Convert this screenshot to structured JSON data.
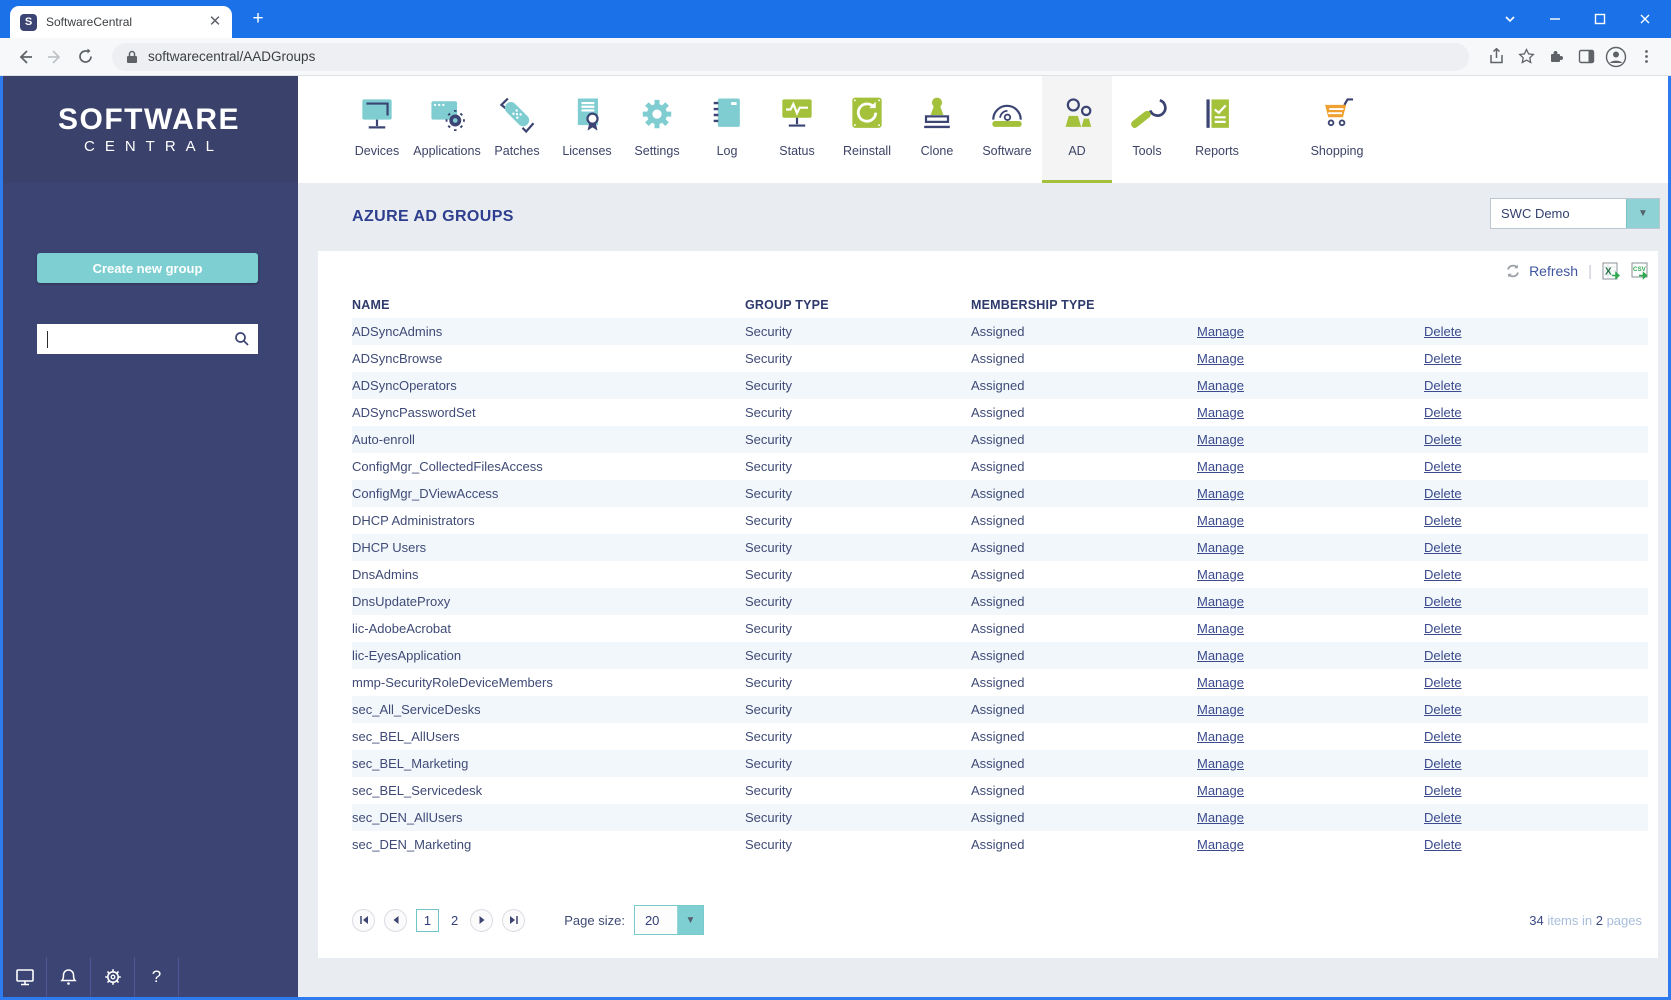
{
  "browser": {
    "tab_title": "SoftwareCentral",
    "favicon_letter": "S",
    "url": "softwarecentral/AADGroups",
    "new_tab_label": "+"
  },
  "sidebar": {
    "logo_line1": "SOFTWARE",
    "logo_line2": "CENTRAL",
    "create_button_label": "Create new group",
    "search_value": ""
  },
  "nav": {
    "active_label": "AD",
    "items": [
      {
        "label": "Devices",
        "icon": "devices-icon"
      },
      {
        "label": "Applications",
        "icon": "applications-icon"
      },
      {
        "label": "Patches",
        "icon": "patches-icon"
      },
      {
        "label": "Licenses",
        "icon": "licenses-icon"
      },
      {
        "label": "Settings",
        "icon": "settings-icon"
      },
      {
        "label": "Log",
        "icon": "log-icon"
      },
      {
        "label": "Status",
        "icon": "status-icon"
      },
      {
        "label": "Reinstall",
        "icon": "reinstall-icon"
      },
      {
        "label": "Clone",
        "icon": "clone-icon"
      },
      {
        "label": "Software",
        "icon": "software-icon"
      },
      {
        "label": "AD",
        "icon": "ad-icon"
      },
      {
        "label": "Tools",
        "icon": "tools-icon"
      },
      {
        "label": "Reports",
        "icon": "reports-icon"
      },
      {
        "label": "Shopping",
        "icon": "shopping-icon",
        "gap_before": true
      }
    ]
  },
  "page": {
    "title": "AZURE AD GROUPS",
    "environment_value": "SWC Demo",
    "refresh_label": "Refresh",
    "separator": "|"
  },
  "table": {
    "columns": [
      "NAME",
      "GROUP TYPE",
      "MEMBERSHIP TYPE"
    ],
    "manage_label": "Manage",
    "delete_label": "Delete",
    "rows": [
      {
        "name": "ADSyncAdmins",
        "group_type": "Security",
        "membership_type": "Assigned"
      },
      {
        "name": "ADSyncBrowse",
        "group_type": "Security",
        "membership_type": "Assigned"
      },
      {
        "name": "ADSyncOperators",
        "group_type": "Security",
        "membership_type": "Assigned"
      },
      {
        "name": "ADSyncPasswordSet",
        "group_type": "Security",
        "membership_type": "Assigned"
      },
      {
        "name": "Auto-enroll",
        "group_type": "Security",
        "membership_type": "Assigned"
      },
      {
        "name": "ConfigMgr_CollectedFilesAccess",
        "group_type": "Security",
        "membership_type": "Assigned"
      },
      {
        "name": "ConfigMgr_DViewAccess",
        "group_type": "Security",
        "membership_type": "Assigned"
      },
      {
        "name": "DHCP Administrators",
        "group_type": "Security",
        "membership_type": "Assigned"
      },
      {
        "name": "DHCP Users",
        "group_type": "Security",
        "membership_type": "Assigned"
      },
      {
        "name": "DnsAdmins",
        "group_type": "Security",
        "membership_type": "Assigned"
      },
      {
        "name": "DnsUpdateProxy",
        "group_type": "Security",
        "membership_type": "Assigned"
      },
      {
        "name": "lic-AdobeAcrobat",
        "group_type": "Security",
        "membership_type": "Assigned"
      },
      {
        "name": "lic-EyesApplication",
        "group_type": "Security",
        "membership_type": "Assigned"
      },
      {
        "name": "mmp-SecurityRoleDeviceMembers",
        "group_type": "Security",
        "membership_type": "Assigned"
      },
      {
        "name": "sec_All_ServiceDesks",
        "group_type": "Security",
        "membership_type": "Assigned"
      },
      {
        "name": "sec_BEL_AllUsers",
        "group_type": "Security",
        "membership_type": "Assigned"
      },
      {
        "name": "sec_BEL_Marketing",
        "group_type": "Security",
        "membership_type": "Assigned"
      },
      {
        "name": "sec_BEL_Servicedesk",
        "group_type": "Security",
        "membership_type": "Assigned"
      },
      {
        "name": "sec_DEN_AllUsers",
        "group_type": "Security",
        "membership_type": "Assigned"
      },
      {
        "name": "sec_DEN_Marketing",
        "group_type": "Security",
        "membership_type": "Assigned"
      }
    ]
  },
  "pagination": {
    "pages": [
      "1",
      "2"
    ],
    "current_page": "1",
    "page_size_label": "Page size:",
    "page_size_value": "20",
    "items_count": "34",
    "items_text": " items in ",
    "pages_count": "2",
    "pages_text": " pages"
  }
}
